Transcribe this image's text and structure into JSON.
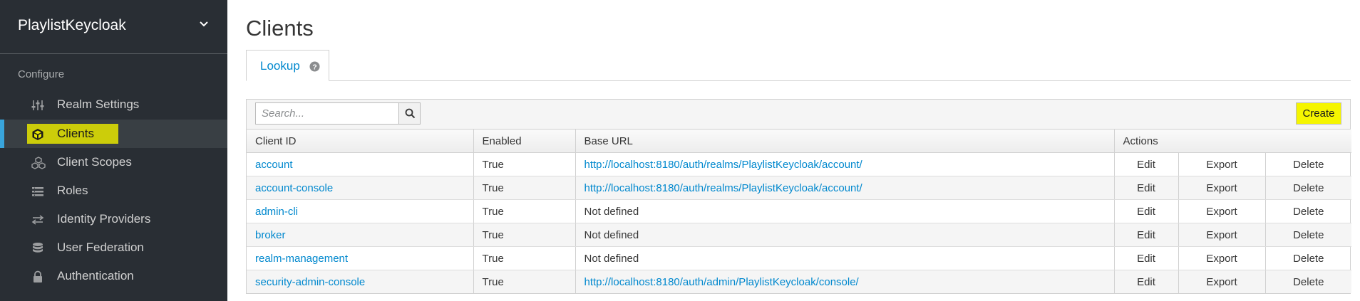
{
  "sidebar": {
    "realm_name": "PlaylistKeycloak",
    "section_label": "Configure",
    "items": [
      {
        "label": "Realm Settings",
        "icon": "sliders-icon",
        "active": false
      },
      {
        "label": "Clients",
        "icon": "cube-icon",
        "active": true
      },
      {
        "label": "Client Scopes",
        "icon": "cubes-icon",
        "active": false
      },
      {
        "label": "Roles",
        "icon": "list-icon",
        "active": false
      },
      {
        "label": "Identity Providers",
        "icon": "exchange-icon",
        "active": false
      },
      {
        "label": "User Federation",
        "icon": "database-icon",
        "active": false
      },
      {
        "label": "Authentication",
        "icon": "lock-icon",
        "active": false
      }
    ]
  },
  "main": {
    "title": "Clients",
    "tabs": [
      {
        "label": "Lookup",
        "icon": "help-icon",
        "active": true
      }
    ],
    "search": {
      "placeholder": "Search...",
      "value": ""
    },
    "create_label": "Create",
    "table": {
      "columns": [
        "Client ID",
        "Enabled",
        "Base URL",
        "Actions"
      ],
      "rows": [
        {
          "client_id": "account",
          "enabled": "True",
          "base_url": "http://localhost:8180/auth/realms/PlaylistKeycloak/account/",
          "base_url_defined": true
        },
        {
          "client_id": "account-console",
          "enabled": "True",
          "base_url": "http://localhost:8180/auth/realms/PlaylistKeycloak/account/",
          "base_url_defined": true
        },
        {
          "client_id": "admin-cli",
          "enabled": "True",
          "base_url": "Not defined",
          "base_url_defined": false
        },
        {
          "client_id": "broker",
          "enabled": "True",
          "base_url": "Not defined",
          "base_url_defined": false
        },
        {
          "client_id": "realm-management",
          "enabled": "True",
          "base_url": "Not defined",
          "base_url_defined": false
        },
        {
          "client_id": "security-admin-console",
          "enabled": "True",
          "base_url": "http://localhost:8180/auth/admin/PlaylistKeycloak/console/",
          "base_url_defined": true
        }
      ],
      "actions": [
        "Edit",
        "Export",
        "Delete"
      ]
    }
  },
  "colors": {
    "sidebar_bg": "#292e34",
    "active_accent": "#39a5dc",
    "link": "#0088ce",
    "highlight": "#f5f500"
  }
}
